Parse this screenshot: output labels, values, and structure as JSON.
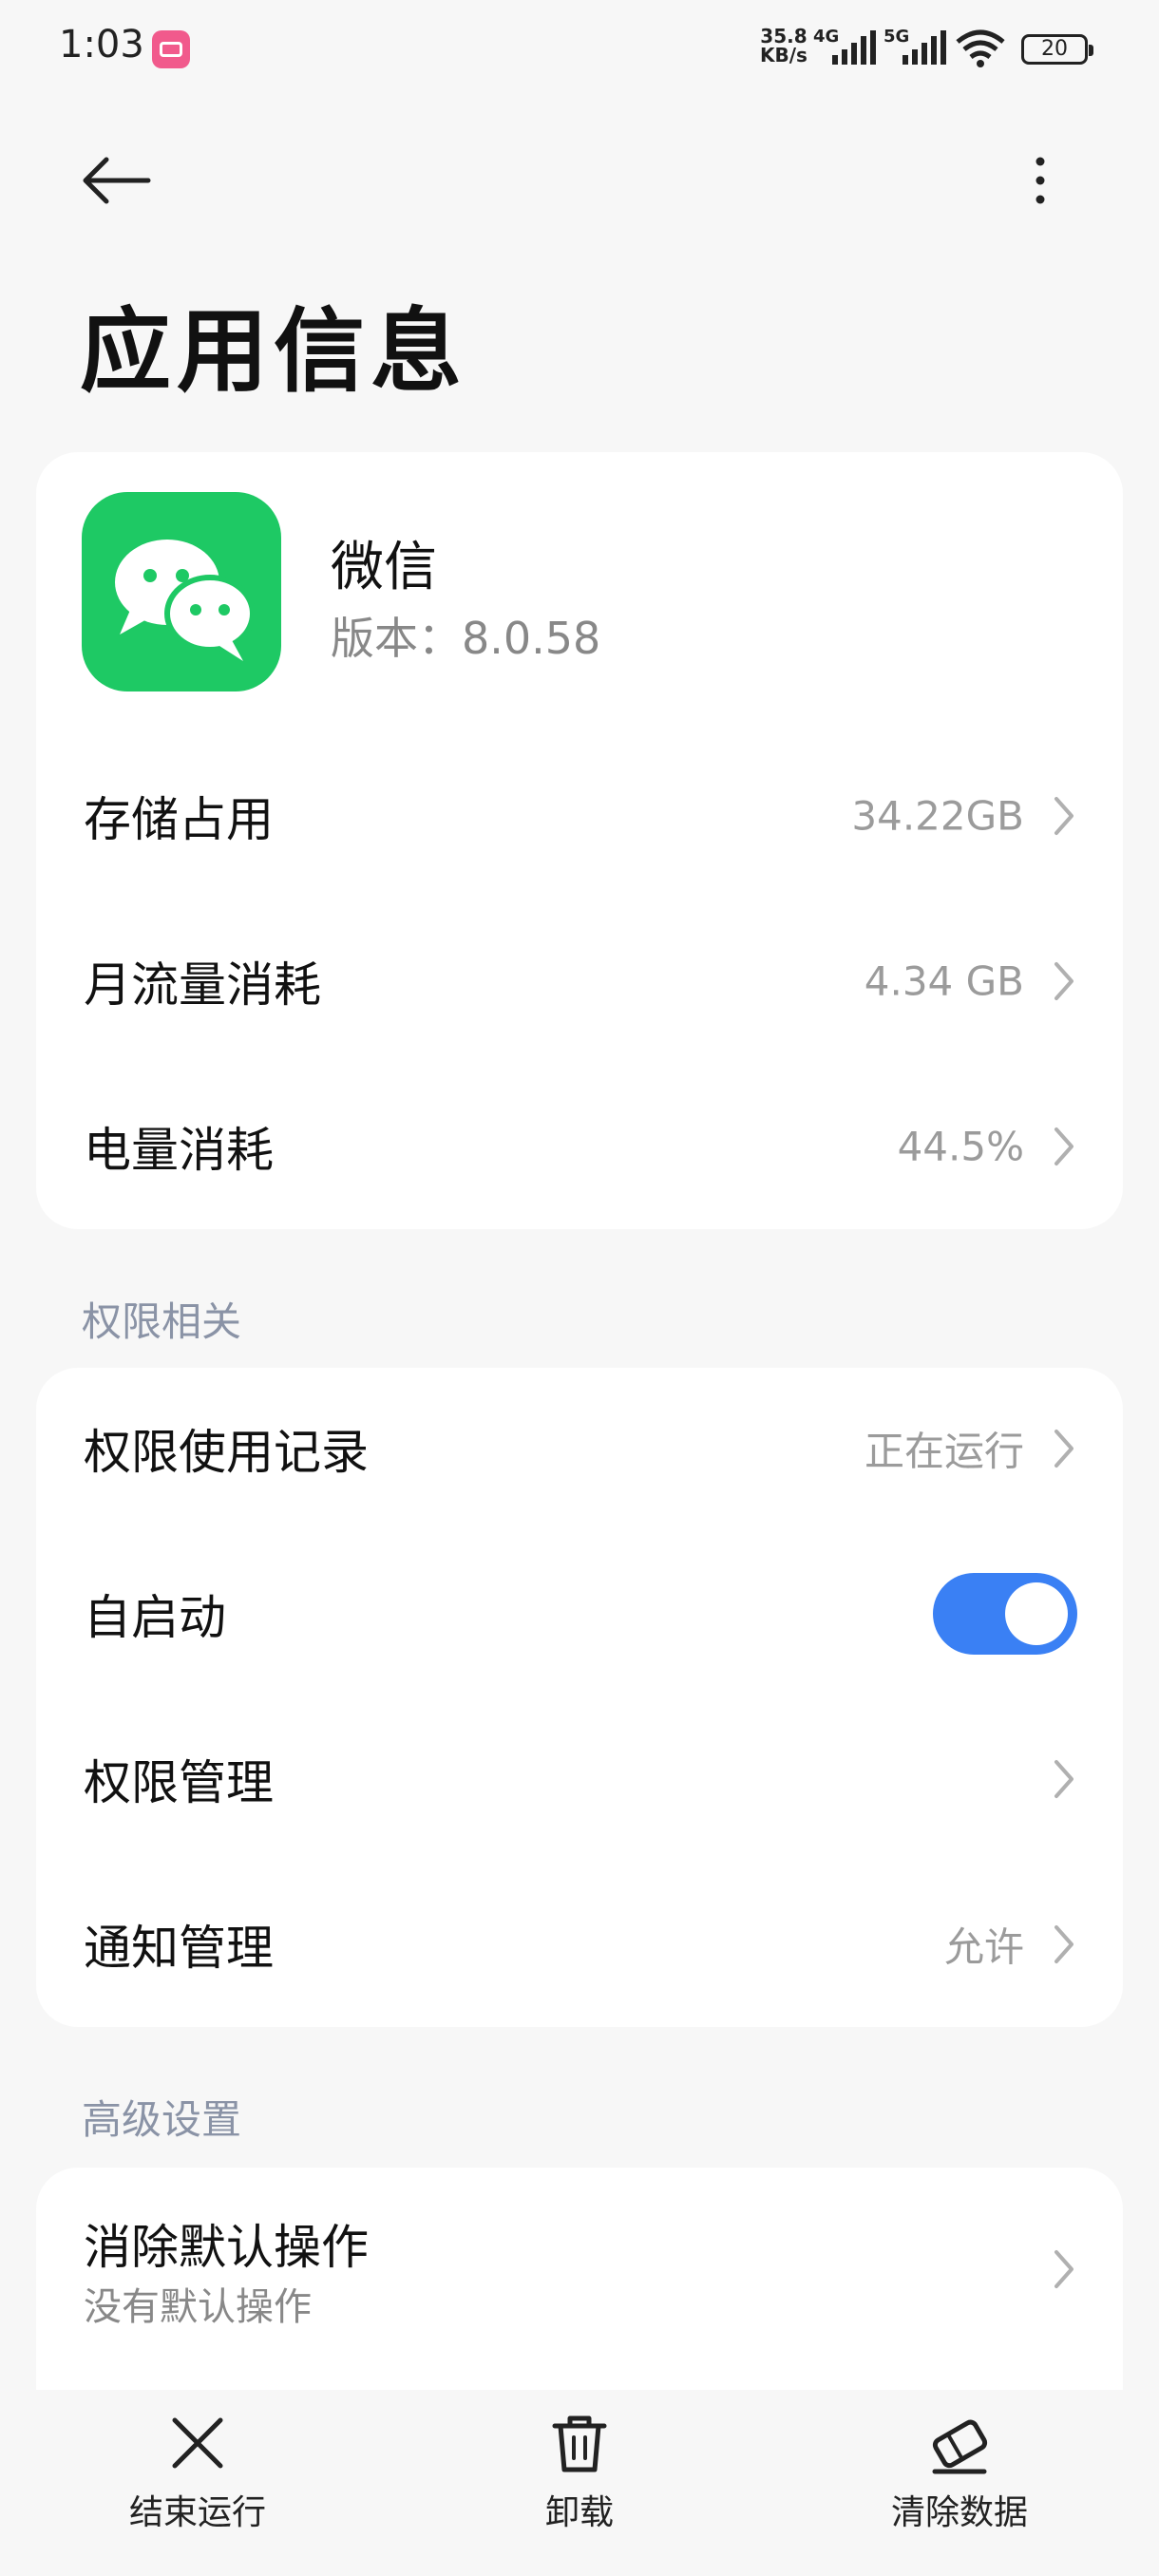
{
  "status_bar": {
    "time": "1:03",
    "net_speed_value": "35.8",
    "net_speed_unit": "KB/s",
    "sim1": "4G",
    "sim2": "5G",
    "battery": "20"
  },
  "header": {
    "title": "应用信息"
  },
  "app": {
    "name": "微信",
    "version": "版本：8.0.58",
    "icon": "wechat-icon"
  },
  "info_rows": [
    {
      "label": "存储占用",
      "value": "34.22GB"
    },
    {
      "label": "月流量消耗",
      "value": "4.34 GB"
    },
    {
      "label": "电量消耗",
      "value": "44.5%"
    }
  ],
  "permissions": {
    "section_title": "权限相关",
    "rows": [
      {
        "label": "权限使用记录",
        "value": "正在运行"
      },
      {
        "label": "自启动",
        "toggle": true
      },
      {
        "label": "权限管理",
        "value": ""
      },
      {
        "label": "通知管理",
        "value": "允许"
      }
    ]
  },
  "advanced": {
    "section_title": "高级设置",
    "rows": [
      {
        "label": "消除默认操作",
        "subtext": "没有默认操作"
      }
    ]
  },
  "bottom_actions": [
    {
      "label": "结束运行",
      "icon": "close-icon"
    },
    {
      "label": "卸载",
      "icon": "trash-icon"
    },
    {
      "label": "清除数据",
      "icon": "eraser-icon"
    }
  ],
  "colors": {
    "accent": "#3a80f4",
    "wechat_green": "#1ec964",
    "background": "#f7f7f7",
    "secondary_text": "#9b9b9b",
    "section_text": "#8a93a6"
  }
}
